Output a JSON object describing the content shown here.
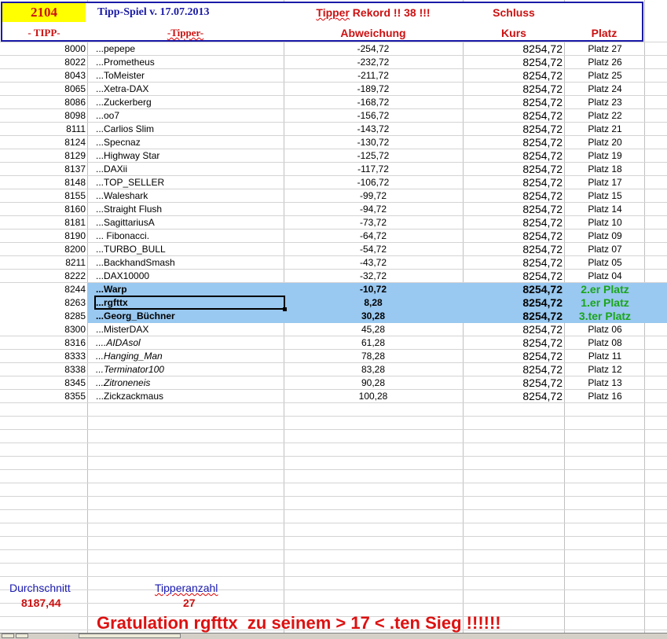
{
  "header": {
    "tip_count": "2104",
    "game_title": "Tipp-Spiel v. 17.07.2013",
    "record_text": "Tipper Rekord !!  38  !!!",
    "close_label": "Schluss",
    "col_tipp": "- TIPP-",
    "col_tipper": "-Tipper-",
    "col_abweichung": "Abweichung",
    "col_kurs": "Kurs",
    "col_platz": "Platz"
  },
  "rows": [
    {
      "tipp": "8000",
      "name": "...pepepe",
      "abw": "-254,72",
      "kurs": "8254,72",
      "platz": "Platz 27"
    },
    {
      "tipp": "8022",
      "name": "...Prometheus",
      "abw": "-232,72",
      "kurs": "8254,72",
      "platz": "Platz 26"
    },
    {
      "tipp": "8043",
      "name": "...ToMeister",
      "abw": "-211,72",
      "kurs": "8254,72",
      "platz": "Platz 25"
    },
    {
      "tipp": "8065",
      "name": "...Xetra-DAX",
      "abw": "-189,72",
      "kurs": "8254,72",
      "platz": "Platz 24"
    },
    {
      "tipp": "8086",
      "name": "...Zuckerberg",
      "abw": "-168,72",
      "kurs": "8254,72",
      "platz": "Platz 23"
    },
    {
      "tipp": "8098",
      "name": "...oo7",
      "abw": "-156,72",
      "kurs": "8254,72",
      "platz": "Platz 22"
    },
    {
      "tipp": "8111",
      "name": "...Carlios Slim",
      "abw": "-143,72",
      "kurs": "8254,72",
      "platz": "Platz 21"
    },
    {
      "tipp": "8124",
      "name": "...Specnaz",
      "abw": "-130,72",
      "kurs": "8254,72",
      "platz": "Platz 20"
    },
    {
      "tipp": "8129",
      "name": "...Highway Star",
      "abw": "-125,72",
      "kurs": "8254,72",
      "platz": "Platz 19"
    },
    {
      "tipp": "8137",
      "name": "...DAXii",
      "abw": "-117,72",
      "kurs": "8254,72",
      "platz": "Platz 18"
    },
    {
      "tipp": "8148",
      "name": "...TOP_SELLER",
      "abw": "-106,72",
      "kurs": "8254,72",
      "platz": "Platz 17"
    },
    {
      "tipp": "8155",
      "name": "...Waleshark",
      "abw": "-99,72",
      "kurs": "8254,72",
      "platz": "Platz 15"
    },
    {
      "tipp": "8160",
      "name": "...Straight Flush",
      "abw": "-94,72",
      "kurs": "8254,72",
      "platz": "Platz 14"
    },
    {
      "tipp": "8181",
      "name": "...SagittariusA",
      "abw": "-73,72",
      "kurs": "8254,72",
      "platz": "Platz 10"
    },
    {
      "tipp": "8190",
      "name": "... Fibonacci.",
      "abw": "-64,72",
      "kurs": "8254,72",
      "platz": "Platz 09"
    },
    {
      "tipp": "8200",
      "name": "...TURBO_BULL",
      "abw": "-54,72",
      "kurs": "8254,72",
      "platz": "Platz 07"
    },
    {
      "tipp": "8211",
      "name": "...BackhandSmash",
      "abw": "-43,72",
      "kurs": "8254,72",
      "platz": "Platz 05"
    },
    {
      "tipp": "8222",
      "name": "...DAX10000",
      "abw": "-32,72",
      "kurs": "8254,72",
      "platz": "Platz 04"
    },
    {
      "tipp": "8244",
      "name": "...Warp",
      "abw": "-10,72",
      "kurs": "8254,72",
      "platz": "2.er Platz",
      "top": true
    },
    {
      "tipp": "8263",
      "name": "...rgfttx",
      "abw": "8,28",
      "kurs": "8254,72",
      "platz": "1.er Platz",
      "top": true
    },
    {
      "tipp": "8285",
      "name": "...Georg_Büchner",
      "abw": "30,28",
      "kurs": "8254,72",
      "platz": "3.ter Platz",
      "top": true
    },
    {
      "tipp": "8300",
      "name": "...MisterDAX",
      "abw": "45,28",
      "kurs": "8254,72",
      "platz": "Platz 06"
    },
    {
      "tipp": "8316",
      "name": "....AIDAsol",
      "abw": "61,28",
      "kurs": "8254,72",
      "platz": "Platz 08",
      "italic": true
    },
    {
      "tipp": "8333",
      "name": "...Hanging_Man",
      "abw": "78,28",
      "kurs": "8254,72",
      "platz": "Platz 11",
      "italic": true
    },
    {
      "tipp": "8338",
      "name": "...Terminator100",
      "abw": "83,28",
      "kurs": "8254,72",
      "platz": "Platz 12",
      "italic": true
    },
    {
      "tipp": "8345",
      "name": "...Zitroneneis",
      "abw": "90,28",
      "kurs": "8254,72",
      "platz": "Platz 13",
      "italic": true
    },
    {
      "tipp": "8355",
      "name": "...Zickzackmaus",
      "abw": "100,28",
      "kurs": "8254,72",
      "platz": "Platz 16"
    }
  ],
  "footer": {
    "average_label": "Durchschnitt",
    "average_value": "8187,44",
    "count_label": "Tipperanzahl",
    "count_value": "27",
    "congrats": "Gratulation rgfttx  zu seinem > 17 < .ten Sieg !!!!!!"
  },
  "colors": {
    "header_border": "#1a1aa8",
    "header_red": "#cc1111",
    "tip_count_bg": "#ffff00",
    "highlight": "#99c8f0",
    "winner_green": "#1aa51a",
    "footer_blue": "#1a1ab0"
  }
}
